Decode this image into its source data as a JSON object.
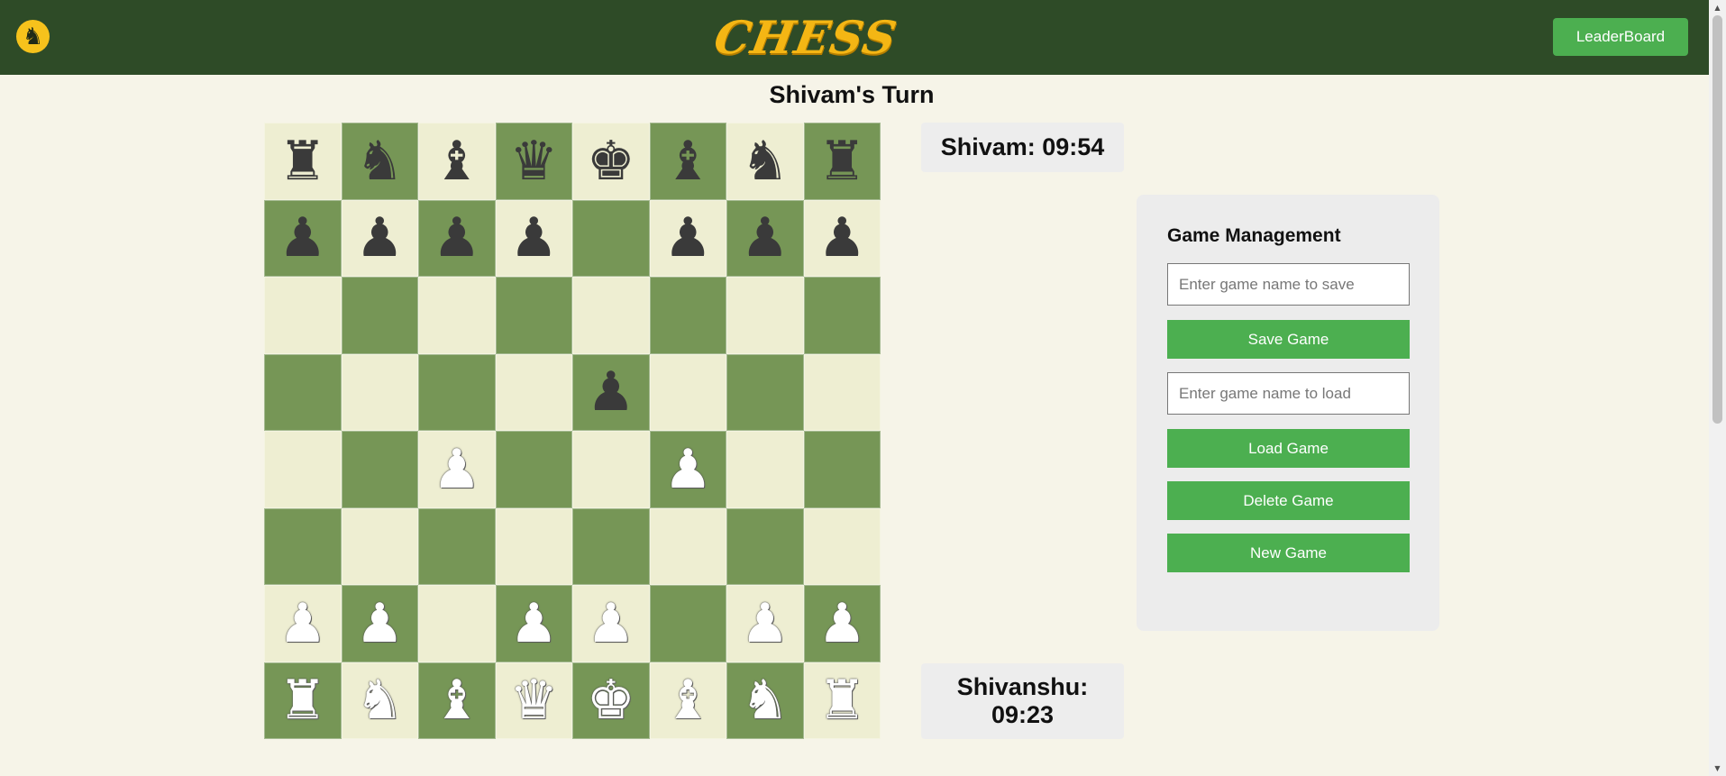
{
  "header": {
    "logo_icon": "knight-logo-icon",
    "logo_glyph": "♞",
    "brand": "CHESS",
    "leaderboard_label": "LeaderBoard"
  },
  "turn": {
    "title": "Shivam's Turn"
  },
  "timers": {
    "top": "Shivam: 09:54",
    "bottom_line1": "Shivanshu:",
    "bottom_line2": "09:23"
  },
  "board": {
    "rows": [
      [
        "br",
        "bn",
        "bb",
        "bq",
        "bk",
        "bb",
        "bn",
        "br"
      ],
      [
        "bp",
        "bp",
        "bp",
        "bp",
        "",
        "bp",
        "bp",
        "bp"
      ],
      [
        "",
        "",
        "",
        "",
        "",
        "",
        "",
        ""
      ],
      [
        "",
        "",
        "",
        "",
        "bp",
        "",
        "",
        ""
      ],
      [
        "",
        "",
        "wp",
        "",
        "",
        "wp",
        "",
        ""
      ],
      [
        "",
        "",
        "",
        "",
        "",
        "",
        "",
        ""
      ],
      [
        "wp",
        "wp",
        "",
        "wp",
        "wp",
        "",
        "wp",
        "wp"
      ],
      [
        "wr",
        "wn",
        "wb",
        "wq",
        "wk",
        "wb",
        "wn",
        "wr"
      ]
    ],
    "light_color": "#eeeed2",
    "dark_color": "#769656"
  },
  "management": {
    "title": "Game Management",
    "save_placeholder": "Enter game name to save",
    "save_label": "Save Game",
    "load_placeholder": "Enter game name to load",
    "load_label": "Load Game",
    "delete_label": "Delete Game",
    "new_label": "New Game"
  },
  "colors": {
    "header_bg": "#2e4b27",
    "accent_green": "#4caf50",
    "brand_yellow": "#f4b614",
    "page_bg": "#f6f4e8"
  }
}
